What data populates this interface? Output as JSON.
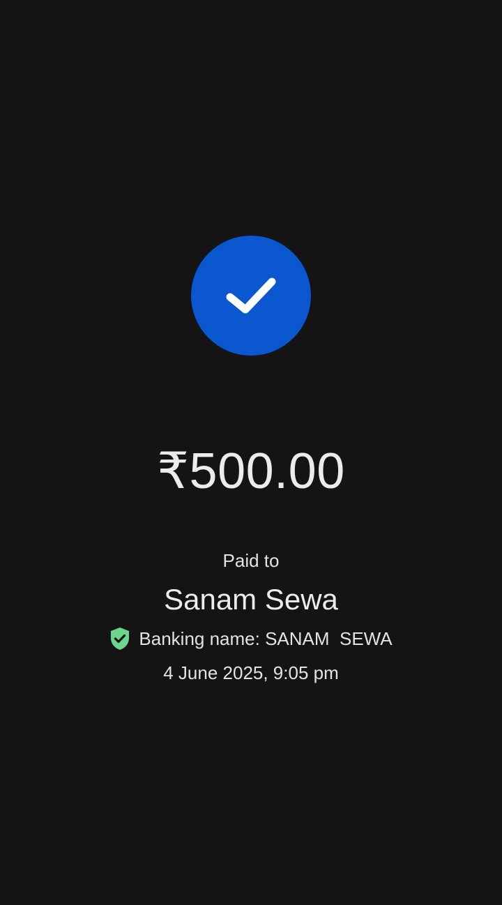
{
  "status": {
    "icon": "check-icon",
    "circle_color": "#0b57d0"
  },
  "payment": {
    "amount": "₹500.00",
    "paid_to_label": "Paid to",
    "payee_name": "Sanam Sewa",
    "banking_name": "Banking name: SANAM  SEWA",
    "verified_icon": "verified-shield-icon",
    "verified_color": "#6dd58c",
    "datetime": "4 June 2025, 9:05 pm"
  }
}
